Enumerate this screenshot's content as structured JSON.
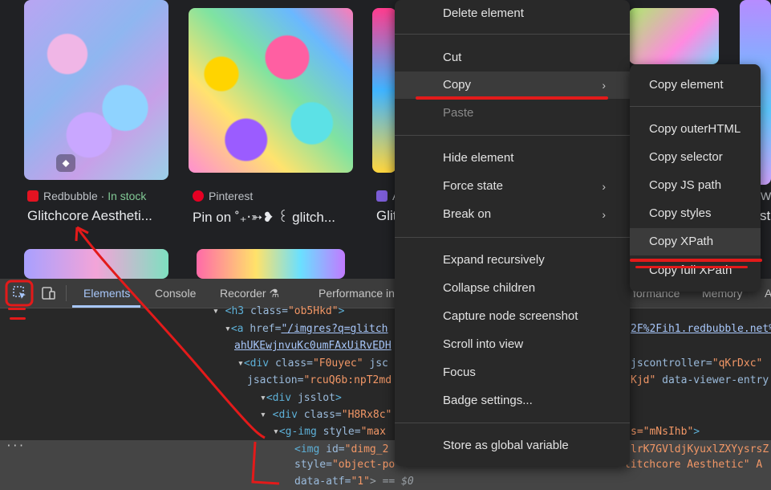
{
  "results": {
    "items": [
      {
        "source": "Redbubble",
        "separator": " · ",
        "stock": "In stock",
        "title": "Glitchcore Aestheti..."
      },
      {
        "source": "Pinterest",
        "title": "Pin on ˚₊‧➳❥ ꒰ glitch..."
      },
      {
        "source": "A",
        "title": "Glit"
      },
      {
        "title": "st"
      }
    ],
    "tag_icon": "tag-icon"
  },
  "devtools": {
    "tabs": [
      "Elements",
      "Console",
      "Recorder",
      "Performance in",
      "formance",
      "Memory",
      "A"
    ],
    "inspect_icon": "inspect-element-icon",
    "device_icon": "device-toolbar-icon",
    "code_lines": [
      {
        "indent": 265,
        "text_tag": "<h3 ",
        "attr": "class=",
        "val": "\"ob5Hkd\"",
        "end": ">"
      },
      {
        "indent": 280,
        "text_tag": "<a ",
        "attr": "href=",
        "link": "\"/imgres?q=glitch",
        "right": "2F%2Fih1.redbubble.net%"
      },
      {
        "indent": 292,
        "link": "ahUKEwjnvuKc0umFAxUiRvEDH"
      },
      {
        "indent": 296,
        "text_tag": "<div ",
        "attr": "class=",
        "val": "\"F0uyec\"",
        "tail": " jsc",
        "right_attr": "jscontroller=",
        "right_val": "\"qKrDxc\""
      },
      {
        "indent": 308,
        "attr": "jsaction=",
        "val": "\"rcuQ6b:npT2md",
        "right_val": "Kjd\"",
        "right_attr": " data-viewer-entry"
      },
      {
        "indent": 324,
        "text_tag": "<div ",
        "attr": "jsslot",
        "end": ">"
      },
      {
        "indent": 338,
        "text_tag": "<div ",
        "attr": "class=",
        "val": "\"H8Rx8c\""
      },
      {
        "indent": 353,
        "text_tag": "<g-img ",
        "attr": "style=",
        "val": "\"max",
        "right_val": "s=\"mNsIhb\"",
        "right_end": ">"
      },
      {
        "indent": 367,
        "text_tag": "<img ",
        "attr": "id=",
        "val": "\"dimg_2",
        "right_val": "lrK7GVldjKyuxlZXYysrsZ"
      },
      {
        "indent": 367,
        "attr": "style=",
        "val": "\"object-po",
        "right_val": "litchcore Aesthetic\" A"
      },
      {
        "indent": 367,
        "attr": "data-atf=",
        "val": "\"1\"",
        "end": "> == $0"
      }
    ],
    "ellipsis": "···"
  },
  "context_menu": {
    "items": [
      {
        "label": "Delete element"
      },
      {
        "sep": true
      },
      {
        "label": "Cut"
      },
      {
        "label": "Copy",
        "submenu": true,
        "highlighted": true
      },
      {
        "label": "Paste",
        "disabled": true
      },
      {
        "sep": true
      },
      {
        "label": "Hide element"
      },
      {
        "label": "Force state",
        "submenu": true
      },
      {
        "label": "Break on",
        "submenu": true
      },
      {
        "sep": true
      },
      {
        "label": "Expand recursively"
      },
      {
        "label": "Collapse children"
      },
      {
        "label": "Capture node screenshot"
      },
      {
        "label": "Scroll into view"
      },
      {
        "label": "Focus"
      },
      {
        "label": "Badge settings..."
      },
      {
        "sep": true
      },
      {
        "label": "Store as global variable"
      }
    ],
    "arrow_glyph": "›"
  },
  "copy_submenu": {
    "items": [
      {
        "label": "Copy element"
      },
      {
        "sep": true
      },
      {
        "label": "Copy outerHTML"
      },
      {
        "label": "Copy selector"
      },
      {
        "label": "Copy JS path"
      },
      {
        "label": "Copy styles"
      },
      {
        "label": "Copy XPath",
        "highlighted": true
      },
      {
        "label": "Copy full XPath"
      }
    ]
  },
  "colors": {
    "annotation_red": "#e31a1a",
    "accent": "#a8c7fa"
  }
}
